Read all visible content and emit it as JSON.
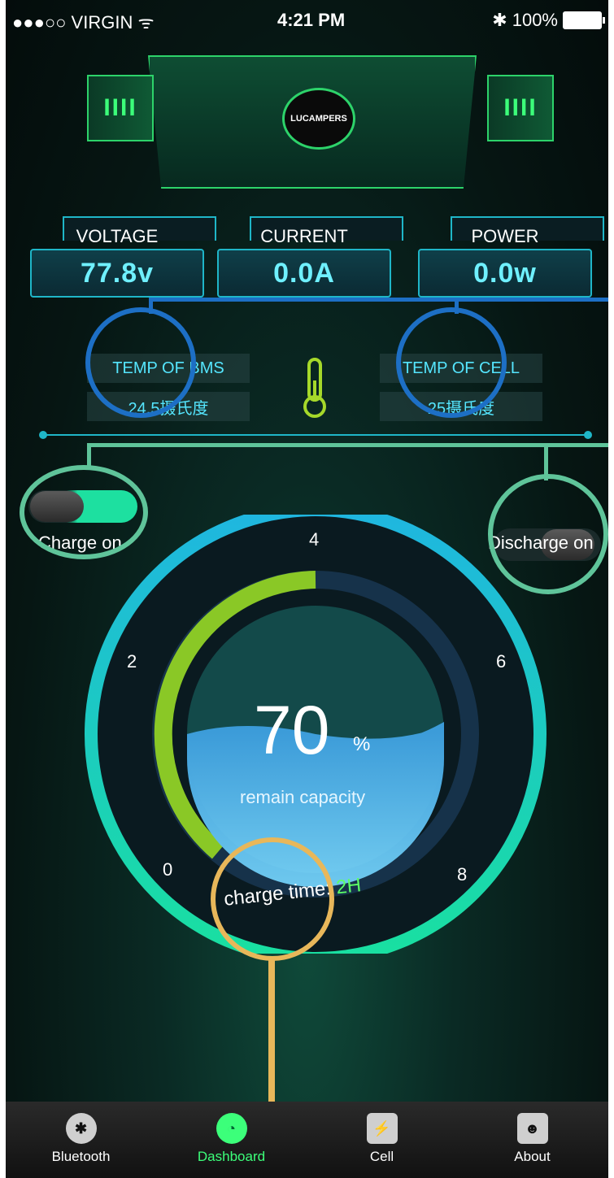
{
  "status_bar": {
    "carrier": "●●●○○ VIRGIN",
    "wifi_icon": "wifi-icon",
    "time": "4:21 PM",
    "bluetooth_icon": "bluetooth-icon",
    "battery": "100%"
  },
  "header": {
    "logo_text": "LUCAMPERS",
    "left_bars": "IIII",
    "right_bars": "IIII"
  },
  "metrics": [
    {
      "label": "VOLTAGE",
      "value": "77.8v"
    },
    {
      "label": "CURRENT",
      "value": "0.0A"
    },
    {
      "label": "POWER",
      "value": "0.0w"
    }
  ],
  "temps": {
    "bms_label": "TEMP OF BMS",
    "bms_value": "24.5摄氏度",
    "cell_label": "TEMP OF CELL",
    "cell_value": "25摄氏度",
    "icon": "thermometer-icon"
  },
  "toggles": {
    "charge": {
      "label": "Charge on",
      "state": "on"
    },
    "discharge": {
      "label": "Discharge on",
      "state": "off"
    }
  },
  "gauge": {
    "ticks": [
      "0",
      "2",
      "4",
      "6",
      "8"
    ],
    "percent": "70",
    "percent_unit": "%",
    "caption": "remain capacity",
    "charge_time_label": "charge time:",
    "charge_time_value": "2H"
  },
  "tabbar": {
    "items": [
      {
        "label": "Bluetooth",
        "icon": "bluetooth-icon",
        "active": false
      },
      {
        "label": "Dashboard",
        "icon": "dashboard-icon",
        "active": true
      },
      {
        "label": "Cell",
        "icon": "cell-icon",
        "active": false
      },
      {
        "label": "About",
        "icon": "person-icon",
        "active": false
      }
    ]
  },
  "colors": {
    "accent_green": "#2dd36a",
    "accent_cyan": "#1fb6c8",
    "annotation_blue": "#1d6fc5",
    "annotation_green": "#5fc49a",
    "annotation_yellow": "#e8b75a"
  }
}
